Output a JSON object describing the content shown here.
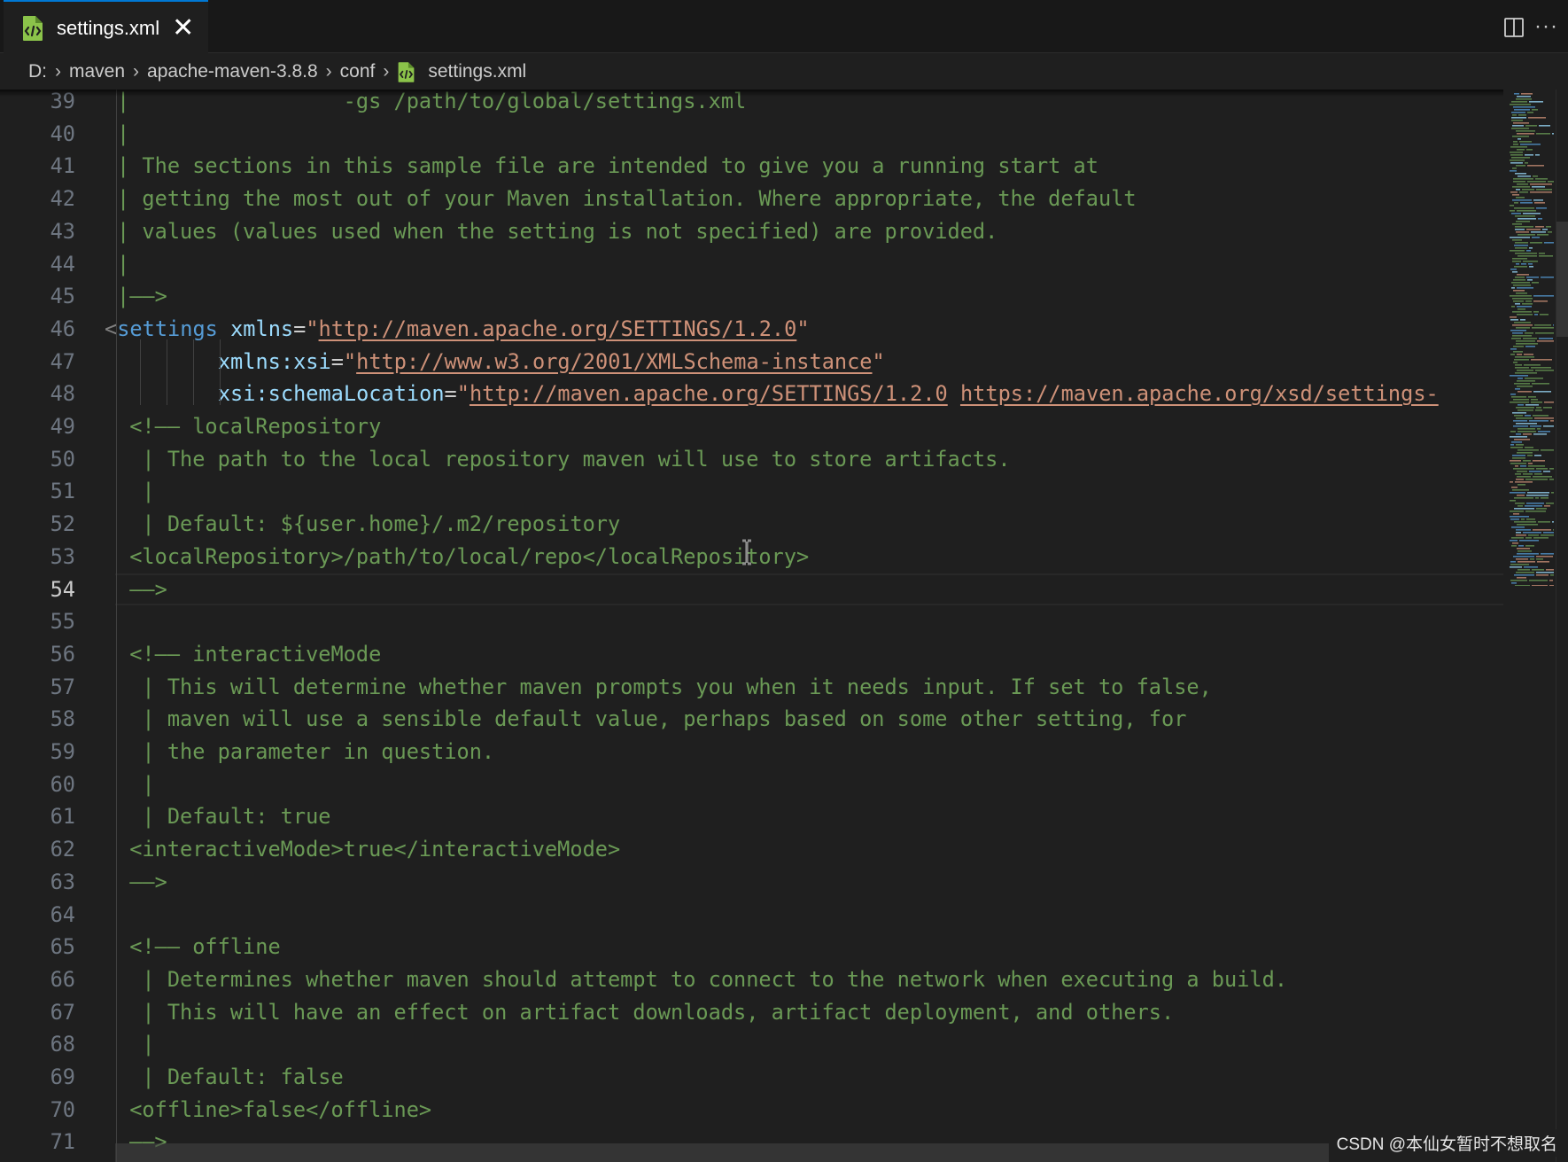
{
  "tab": {
    "label": "settings.xml",
    "close_glyph": "✕",
    "icon": "xml-file-icon"
  },
  "toolbar": {
    "split_icon": "split-editor-icon",
    "more_glyph": "···"
  },
  "breadcrumb": {
    "items": [
      "D:",
      "maven",
      "apache-maven-3.8.8",
      "conf",
      "settings.xml"
    ],
    "sep": "›"
  },
  "editor": {
    "active_line": 54,
    "partial_bottom_line": {
      "number": "71",
      "text": "——>"
    },
    "lines": [
      {
        "n": "39",
        "parts": [
          {
            "t": "|                 -gs /path/to/global/settings.xml",
            "c": "comment"
          }
        ]
      },
      {
        "n": "40",
        "parts": [
          {
            "t": "|",
            "c": "comment"
          }
        ]
      },
      {
        "n": "41",
        "parts": [
          {
            "t": "| The sections in this sample file are intended to give you a running start at",
            "c": "comment"
          }
        ]
      },
      {
        "n": "42",
        "parts": [
          {
            "t": "| getting the most out of your Maven installation. Where appropriate, the default",
            "c": "comment"
          }
        ]
      },
      {
        "n": "43",
        "parts": [
          {
            "t": "| values (values used when the setting is not specified) are provided.",
            "c": "comment"
          }
        ]
      },
      {
        "n": "44",
        "parts": [
          {
            "t": "|",
            "c": "comment"
          }
        ]
      },
      {
        "n": "45",
        "parts": [
          {
            "t": "|——>",
            "c": "comment"
          }
        ]
      },
      {
        "n": "46",
        "parts": [
          {
            "t": "<",
            "c": "bracket"
          },
          {
            "t": "settings",
            "c": "tag"
          },
          {
            "t": " ",
            "c": "eq"
          },
          {
            "t": "xmlns",
            "c": "attr"
          },
          {
            "t": "=",
            "c": "eq"
          },
          {
            "t": "\"",
            "c": "str"
          },
          {
            "t": "http://maven.apache.org/SETTINGS/1.2.0",
            "c": "link"
          },
          {
            "t": "\"",
            "c": "str"
          }
        ],
        "offset": -1
      },
      {
        "n": "47",
        "parts": [
          {
            "t": "         ",
            "c": "eq"
          },
          {
            "t": "xmlns:xsi",
            "c": "attr"
          },
          {
            "t": "=",
            "c": "eq"
          },
          {
            "t": "\"",
            "c": "str"
          },
          {
            "t": "http://www.w3.org/2001/XMLSchema-instance",
            "c": "link"
          },
          {
            "t": "\"",
            "c": "str"
          }
        ],
        "offset": -1
      },
      {
        "n": "48",
        "parts": [
          {
            "t": "         ",
            "c": "eq"
          },
          {
            "t": "xsi:schemaLocation",
            "c": "attr"
          },
          {
            "t": "=",
            "c": "eq"
          },
          {
            "t": "\"",
            "c": "str"
          },
          {
            "t": "http://maven.apache.org/SETTINGS/1.2.0",
            "c": "link"
          },
          {
            "t": " ",
            "c": "str"
          },
          {
            "t": "https://maven.apache.org/xsd/settings-",
            "c": "link"
          }
        ],
        "offset": -1
      },
      {
        "n": "49",
        "parts": [
          {
            "t": " <!—— localRepository",
            "c": "comment"
          }
        ]
      },
      {
        "n": "50",
        "parts": [
          {
            "t": "  | The path to the local repository maven will use to store artifacts.",
            "c": "comment"
          }
        ]
      },
      {
        "n": "51",
        "parts": [
          {
            "t": "  |",
            "c": "comment"
          }
        ]
      },
      {
        "n": "52",
        "parts": [
          {
            "t": "  | Default: ${user.home}/.m2/repository",
            "c": "comment"
          }
        ]
      },
      {
        "n": "53",
        "parts": [
          {
            "t": " <localRepository>/path/to/local/repo</localRepository>",
            "c": "comment"
          }
        ]
      },
      {
        "n": "54",
        "parts": [
          {
            "t": " ——>",
            "c": "comment"
          }
        ]
      },
      {
        "n": "55",
        "parts": [
          {
            "t": "",
            "c": "comment"
          }
        ]
      },
      {
        "n": "56",
        "parts": [
          {
            "t": " <!—— interactiveMode",
            "c": "comment"
          }
        ]
      },
      {
        "n": "57",
        "parts": [
          {
            "t": "  | This will determine whether maven prompts you when it needs input. If set to false,",
            "c": "comment"
          }
        ]
      },
      {
        "n": "58",
        "parts": [
          {
            "t": "  | maven will use a sensible default value, perhaps based on some other setting, for",
            "c": "comment"
          }
        ]
      },
      {
        "n": "59",
        "parts": [
          {
            "t": "  | the parameter in question.",
            "c": "comment"
          }
        ]
      },
      {
        "n": "60",
        "parts": [
          {
            "t": "  |",
            "c": "comment"
          }
        ]
      },
      {
        "n": "61",
        "parts": [
          {
            "t": "  | Default: true",
            "c": "comment"
          }
        ]
      },
      {
        "n": "62",
        "parts": [
          {
            "t": " <interactiveMode>true</interactiveMode>",
            "c": "comment"
          }
        ]
      },
      {
        "n": "63",
        "parts": [
          {
            "t": " ——>",
            "c": "comment"
          }
        ]
      },
      {
        "n": "64",
        "parts": [
          {
            "t": "",
            "c": "comment"
          }
        ]
      },
      {
        "n": "65",
        "parts": [
          {
            "t": " <!—— offline",
            "c": "comment"
          }
        ]
      },
      {
        "n": "66",
        "parts": [
          {
            "t": "  | Determines whether maven should attempt to connect to the network when executing a build.",
            "c": "comment"
          }
        ]
      },
      {
        "n": "67",
        "parts": [
          {
            "t": "  | This will have an effect on artifact downloads, artifact deployment, and others.",
            "c": "comment"
          }
        ]
      },
      {
        "n": "68",
        "parts": [
          {
            "t": "  |",
            "c": "comment"
          }
        ]
      },
      {
        "n": "69",
        "parts": [
          {
            "t": "  | Default: false",
            "c": "comment"
          }
        ]
      },
      {
        "n": "70",
        "parts": [
          {
            "t": " <offline>false</offline>",
            "c": "comment"
          }
        ]
      }
    ]
  },
  "watermark": "CSDN @本仙女暂时不想取名",
  "colors": {
    "accent": "#0078d4",
    "comment": "#6a9955",
    "tag": "#569cd6",
    "attribute": "#9cdcfe",
    "string": "#ce9178",
    "xml_icon": "#8bc34a"
  }
}
